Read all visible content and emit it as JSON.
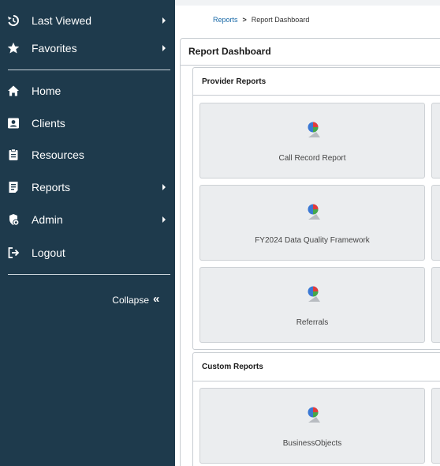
{
  "sidebar": {
    "items": [
      {
        "label": "Last Viewed",
        "icon": "history-icon"
      },
      {
        "label": "Favorites",
        "icon": "star-icon"
      },
      {
        "label": "Home",
        "icon": "home-icon"
      },
      {
        "label": "Clients",
        "icon": "client-card-icon"
      },
      {
        "label": "Resources",
        "icon": "clipboard-icon"
      },
      {
        "label": "Reports",
        "icon": "report-icon"
      },
      {
        "label": "Admin",
        "icon": "admin-gear-icon"
      },
      {
        "label": "Logout",
        "icon": "logout-icon"
      }
    ],
    "collapse_label": "Collapse",
    "collapse_chevron": "«"
  },
  "breadcrumb": {
    "link": "Reports",
    "separator": ">",
    "current": "Report Dashboard"
  },
  "dashboard": {
    "title": "Report Dashboard",
    "sections": [
      {
        "title": "Provider Reports",
        "tiles": [
          "Call Record Report",
          "FY2024 Data Quality Framework",
          "Referrals"
        ]
      },
      {
        "title": "Custom Reports",
        "tiles": [
          "BusinessObjects"
        ]
      }
    ]
  },
  "colors": {
    "sidebar_bg": "#1e3a4c",
    "tile_bg": "#ebedef",
    "link": "#1a6aa8"
  }
}
